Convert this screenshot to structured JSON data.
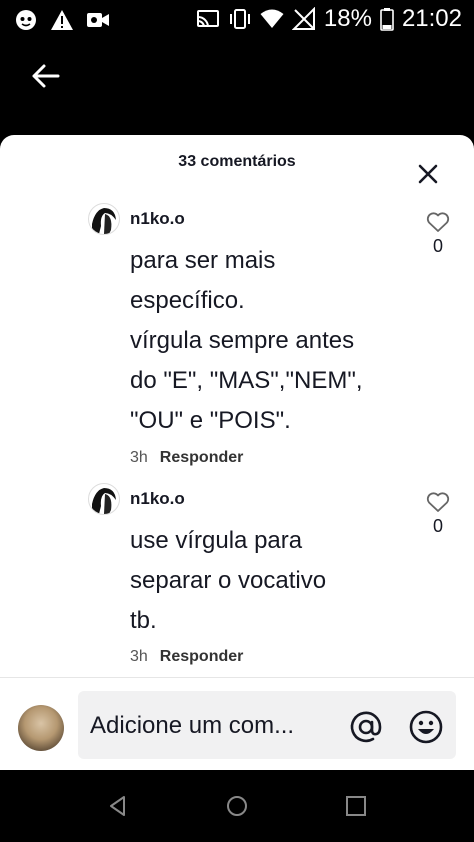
{
  "status_bar": {
    "battery": "18%",
    "time": "21:02",
    "left_icons": [
      "tiktok-notification-icon",
      "warning-icon",
      "video-icon"
    ],
    "right_icons": [
      "cast-icon",
      "vibrate-icon",
      "wifi-icon",
      "no-signal-icon",
      "battery-icon"
    ]
  },
  "header": {
    "back_icon": "arrow-left-icon"
  },
  "sheet": {
    "title": "33 comentários"
  },
  "comments": [
    {
      "username": "n1ko.o",
      "text": "para ser mais\nespecífico.\nvírgula sempre antes\ndo \"E\", \"MAS\",\"NEM\",\n\"OU\" e \"POIS\".",
      "time": "3h",
      "reply_label": "Responder",
      "likes": "0"
    },
    {
      "username": "n1ko.o",
      "text": "use vírgula para\nseparar o vocativo\ntb.",
      "time": "3h",
      "reply_label": "Responder",
      "likes": "0"
    }
  ],
  "composer": {
    "placeholder": "Adicione um com..."
  },
  "colors": {
    "text": "#161823",
    "sheet_bg": "#ffffff",
    "input_bg": "#f1f1f2"
  }
}
